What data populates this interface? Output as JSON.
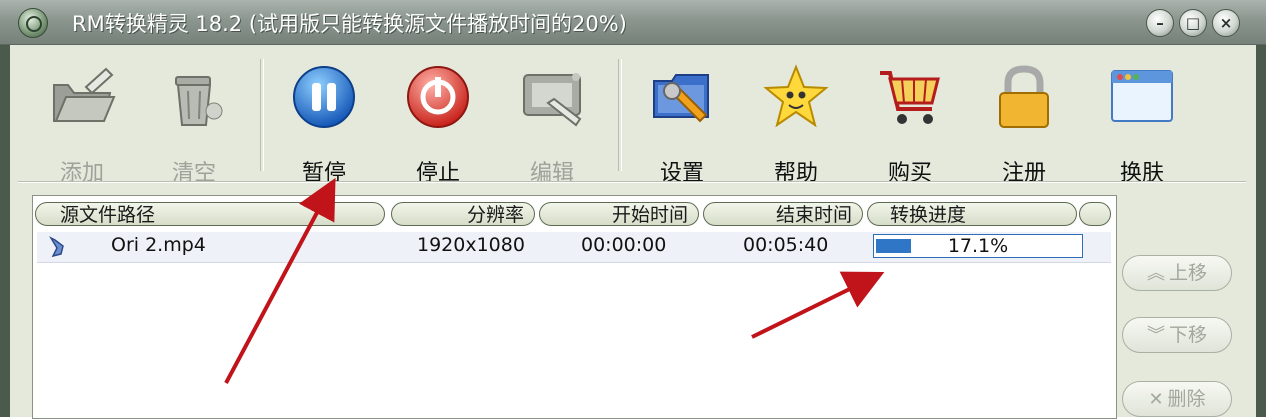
{
  "window": {
    "title": "RM转换精灵 18.2 (试用版只能转换源文件播放时间的20%)"
  },
  "toolbar": {
    "add": "添加",
    "clear": "清空",
    "pause": "暂停",
    "stop": "停止",
    "edit": "编辑",
    "settings": "设置",
    "help": "帮助",
    "buy": "购买",
    "register": "注册",
    "skin": "换肤"
  },
  "columns": {
    "path": "源文件路径",
    "resolution": "分辨率",
    "start": "开始时间",
    "end": "结束时间",
    "progress": "转换进度"
  },
  "rows": [
    {
      "name": "Ori 2.mp4",
      "resolution": "1920x1080",
      "start": "00:00:00",
      "end": "00:05:40",
      "progress_text": "17.1%",
      "progress": 0.171
    }
  ],
  "side": {
    "up": "上移",
    "down": "下移",
    "delete": "删除"
  },
  "colors": {
    "progress": "#2f76c7",
    "arrow": "#c0141a",
    "titlebar": "#8b968f",
    "body": "#e4e9dc"
  }
}
